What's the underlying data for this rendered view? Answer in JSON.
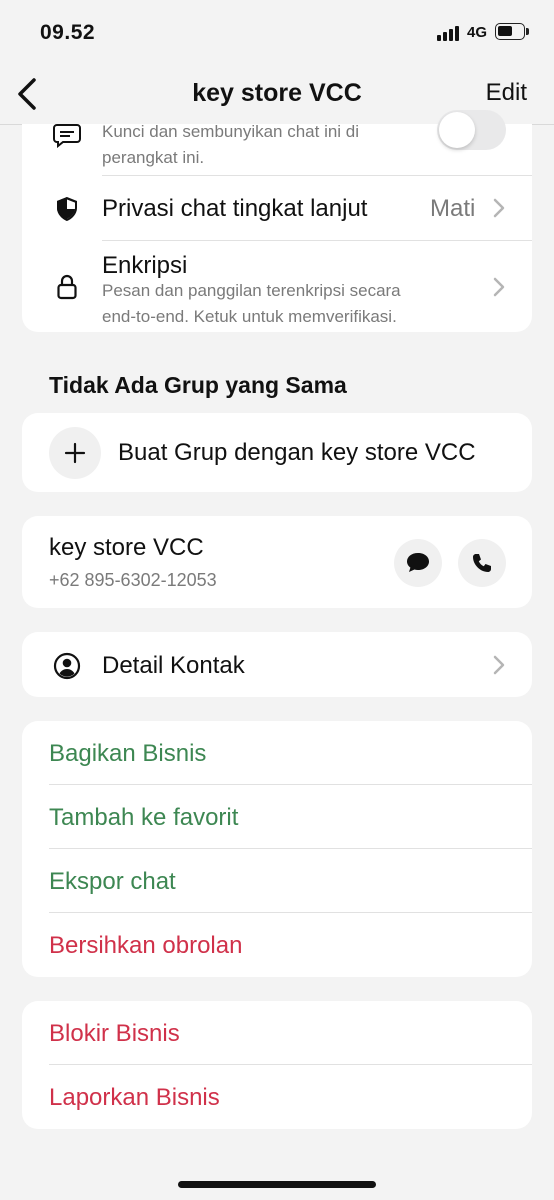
{
  "status_bar": {
    "time": "09.52",
    "network": "4G"
  },
  "nav": {
    "title": "key store VCC",
    "edit_label": "Edit"
  },
  "security_card": {
    "lock_chat_sub_1": "Kunci dan sembunyikan chat ini di",
    "lock_chat_sub_2": "perangkat ini.",
    "lock_chat_toggle_on": false,
    "advanced_privacy": {
      "label": "Privasi chat tingkat lanjut",
      "value": "Mati"
    },
    "encryption": {
      "label": "Enkripsi",
      "sub_1": "Pesan dan panggilan terenkripsi secara",
      "sub_2": "end-to-end. Ketuk untuk memverifikasi."
    }
  },
  "groups": {
    "section_title": "Tidak Ada Grup yang Sama",
    "create_group_label": "Buat Grup dengan key store VCC"
  },
  "contact": {
    "name": "key store VCC",
    "phone": "+62 895-6302-12053"
  },
  "contact_details_label": "Detail Kontak",
  "actions_1": [
    {
      "label": "Bagikan Bisnis",
      "color": "#3d8752"
    },
    {
      "label": "Tambah ke favorit",
      "color": "#3d8752"
    },
    {
      "label": "Ekspor chat",
      "color": "#3d8752"
    },
    {
      "label": "Bersihkan obrolan",
      "color": "#d0314a"
    }
  ],
  "actions_2": [
    {
      "label": "Blokir Bisnis",
      "color": "#d0314a"
    },
    {
      "label": "Laporkan Bisnis",
      "color": "#d0314a"
    }
  ],
  "icons": {
    "status": [
      "signal-icon",
      "battery-icon"
    ],
    "nav": [
      "back-chevron-icon"
    ],
    "rows": [
      "chat-lock-icon",
      "shield-icon",
      "lock-icon",
      "plus-icon",
      "message-icon",
      "phone-icon",
      "person-circle-icon",
      "chevron-right-icon"
    ]
  }
}
